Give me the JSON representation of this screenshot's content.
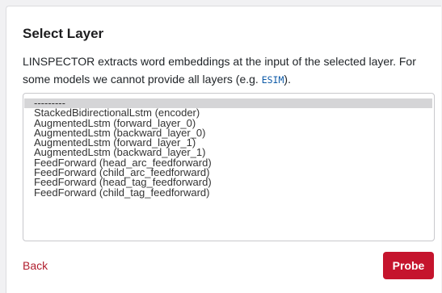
{
  "card": {
    "title": "Select Layer",
    "description_before": "LINSPECTOR extracts word embeddings at the input of the selected layer. For some models we cannot provide all layers (e.g. ",
    "description_code": "ESIM",
    "description_after": ")."
  },
  "layers": {
    "selected_index": 0,
    "options": [
      "---------",
      "StackedBidirectionalLstm (encoder)",
      "AugmentedLstm (forward_layer_0)",
      "AugmentedLstm (backward_layer_0)",
      "AugmentedLstm (forward_layer_1)",
      "AugmentedLstm (backward_layer_1)",
      "FeedForward (head_arc_feedforward)",
      "FeedForward (child_arc_feedforward)",
      "FeedForward (head_tag_feedforward)",
      "FeedForward (child_tag_feedforward)"
    ]
  },
  "actions": {
    "back_label": "Back",
    "probe_label": "Probe"
  },
  "colors": {
    "accent": "#c5142d",
    "link": "#b01e2e",
    "code": "#0d5aa7",
    "selected_option_bg": "#d5d5d7"
  }
}
